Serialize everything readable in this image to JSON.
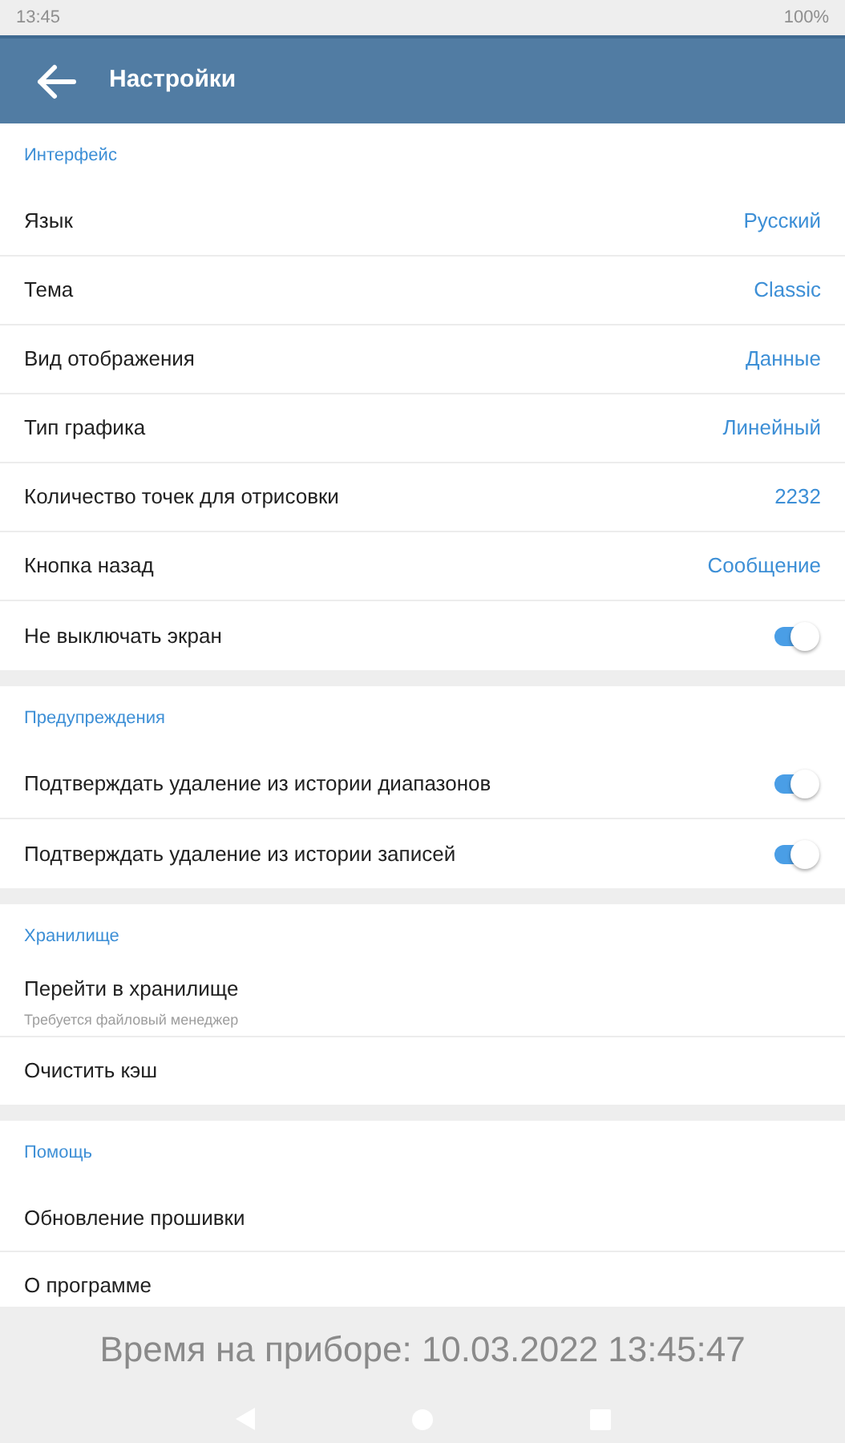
{
  "status_bar": {
    "time": "13:45",
    "battery": "100%"
  },
  "header": {
    "title": "Настройки"
  },
  "sections": [
    {
      "title": "Интерфейс",
      "items": [
        {
          "kind": "value",
          "label": "Язык",
          "value": "Русский"
        },
        {
          "kind": "value",
          "label": "Тема",
          "value": "Classic"
        },
        {
          "kind": "value",
          "label": "Вид отображения",
          "value": "Данные"
        },
        {
          "kind": "value",
          "label": "Тип графика",
          "value": "Линейный"
        },
        {
          "kind": "value",
          "label": "Количество точек для отрисовки",
          "value": "2232"
        },
        {
          "kind": "value",
          "label": "Кнопка назад",
          "value": "Сообщение"
        },
        {
          "kind": "toggle",
          "label": "Не выключать экран",
          "on": true
        }
      ]
    },
    {
      "title": "Предупреждения",
      "items": [
        {
          "kind": "toggle",
          "label": "Подтверждать удаление из истории диапазонов",
          "on": true
        },
        {
          "kind": "toggle",
          "label": "Подтверждать удаление из истории записей",
          "on": true
        }
      ]
    },
    {
      "title": "Хранилище",
      "items": [
        {
          "kind": "subtitle",
          "label": "Перейти в хранилище",
          "subtitle": "Требуется файловый менеджер"
        },
        {
          "kind": "plain",
          "label": "Очистить кэш"
        }
      ]
    },
    {
      "title": "Помощь",
      "items": [
        {
          "kind": "plain",
          "label": "Обновление прошивки"
        },
        {
          "kind": "plain",
          "label": "О программе"
        }
      ]
    }
  ],
  "footer": {
    "device_time": "Время на приборе: 10.03.2022 13:45:47"
  }
}
